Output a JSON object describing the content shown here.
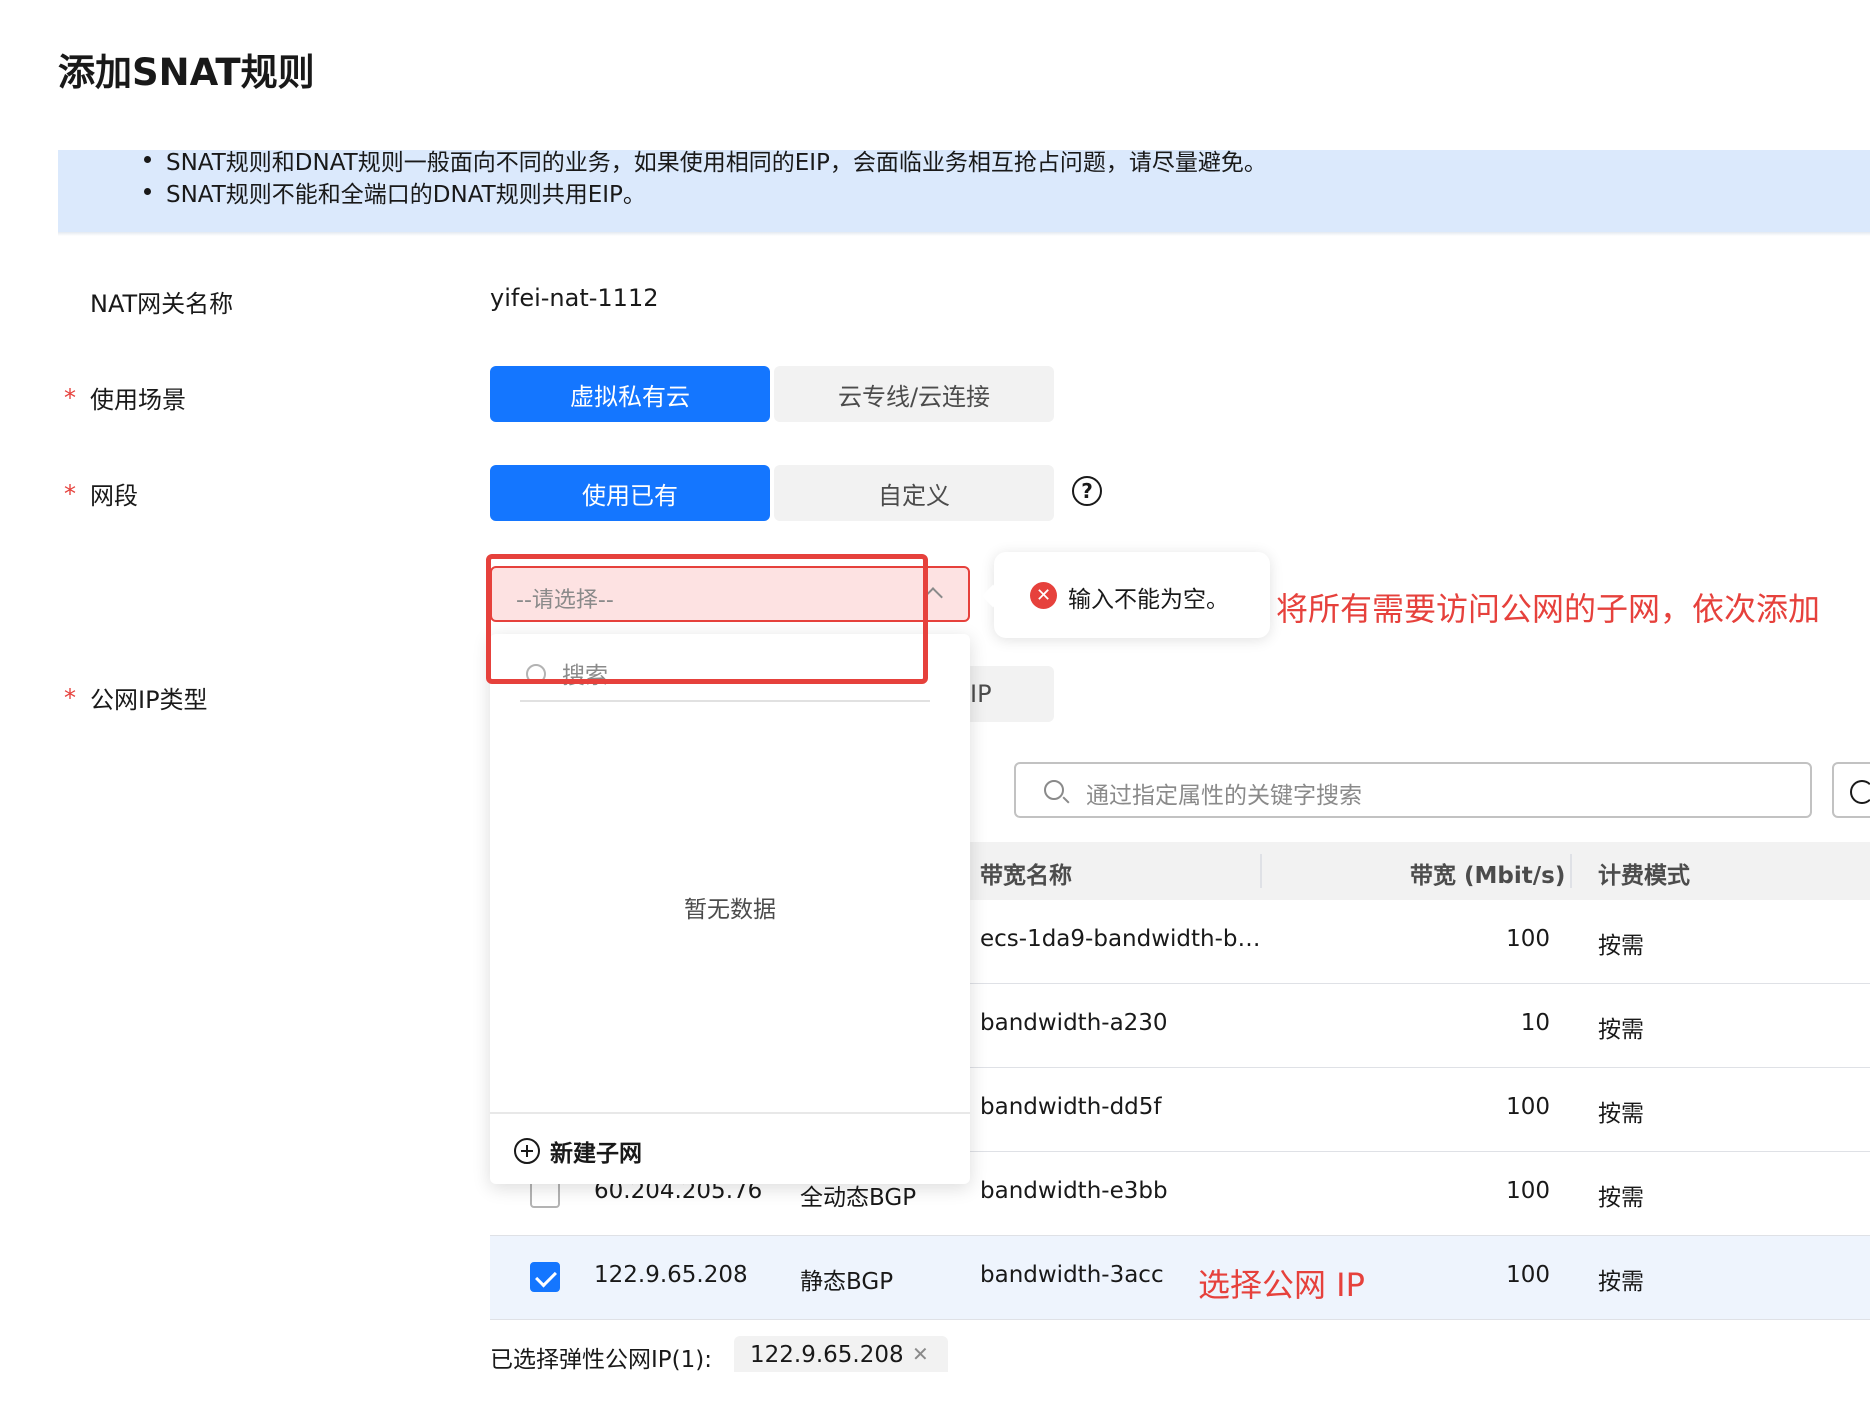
{
  "page": {
    "title": "添加SNAT规则"
  },
  "notice": {
    "line1": "SNAT规则和DNAT规则一般面向不同的业务，如果使用相同的EIP，会面临业务相互抢占问题，请尽量避免。",
    "line2": "SNAT规则不能和全端口的DNAT规则共用EIP。"
  },
  "form": {
    "nat_name": {
      "label": "NAT网关名称",
      "value": "yifei-nat-1112"
    },
    "scenario": {
      "required_mark": "*",
      "label": "使用场景",
      "options": [
        "虚拟私有云",
        "云专线/云连接"
      ],
      "selected": "虚拟私有云"
    },
    "subnet": {
      "required_mark": "*",
      "label": "网段",
      "options": [
        "使用已有",
        "自定义"
      ],
      "selected": "使用已有",
      "help_icon": "question-circle-icon",
      "select_placeholder": "--请选择--",
      "error_message": "输入不能为空。",
      "dropdown": {
        "search_placeholder": "搜索",
        "empty_text": "暂无数据",
        "create_label": "新建子网"
      }
    },
    "public_ip_type": {
      "required_mark": "*",
      "label": "公网IP类型",
      "option_partial": "IP"
    }
  },
  "annotations": {
    "subnet_hint": "将所有需要访问公网的子网，依次添加",
    "select_ip_hint": "选择公网 IP"
  },
  "eip_table": {
    "search_placeholder": "通过指定属性的关键字搜索",
    "columns": [
      "带宽名称",
      "带宽 (Mbit/s)",
      "计费模式"
    ],
    "rows": [
      {
        "ip": "",
        "type": "",
        "bandwidth_name": "ecs-1da9-bandwidth-b…",
        "bandwidth": "100",
        "billing": "按需",
        "checked": false
      },
      {
        "ip": "",
        "type": "",
        "bandwidth_name": "bandwidth-a230",
        "bandwidth": "10",
        "billing": "按需",
        "checked": false
      },
      {
        "ip": "",
        "type": "",
        "bandwidth_name": "bandwidth-dd5f",
        "bandwidth": "100",
        "billing": "按需",
        "checked": false
      },
      {
        "ip": "60.204.205.76",
        "type": "全动态BGP",
        "bandwidth_name": "bandwidth-e3bb",
        "bandwidth": "100",
        "billing": "按需",
        "checked": false
      },
      {
        "ip": "122.9.65.208",
        "type": "静态BGP",
        "bandwidth_name": "bandwidth-3acc",
        "bandwidth": "100",
        "billing": "按需",
        "checked": true
      }
    ],
    "selected_label": "已选择弹性公网IP(1):",
    "selected_tag": "122.9.65.208",
    "remove_icon": "close-icon"
  },
  "colors": {
    "primary": "#1476ff",
    "error": "#e6413c",
    "notice_bg": "#dbe9fc"
  }
}
